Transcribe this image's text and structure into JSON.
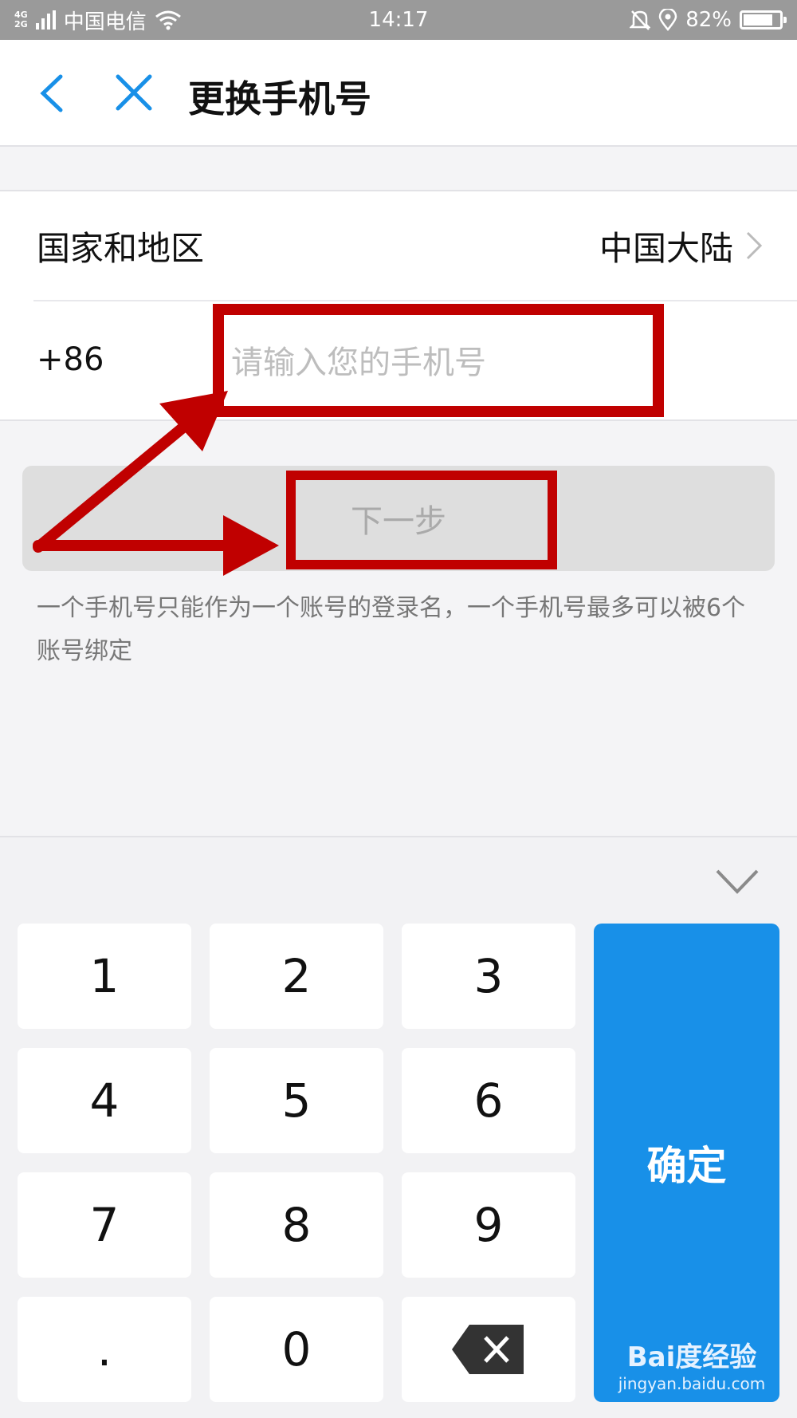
{
  "status_bar": {
    "network_types": [
      "4G",
      "2G"
    ],
    "carrier": "中国电信",
    "time": "14:17",
    "battery": "82%",
    "battery_level": 0.82,
    "icons": [
      "signal-icon",
      "wifi-icon",
      "bell-icon",
      "location-icon",
      "battery-icon"
    ]
  },
  "nav": {
    "title": "更换手机号",
    "icons": [
      "back-icon",
      "close-icon"
    ]
  },
  "form": {
    "region_label": "国家和地区",
    "region_value": "中国大陆",
    "country_code": "+86",
    "phone_placeholder": "请输入您的手机号",
    "phone_value": ""
  },
  "next_button_label": "下一步",
  "hint_text": "一个手机号只能作为一个账号的登录名，一个手机号最多可以被6个账号绑定",
  "keyboard": {
    "keys": [
      "1",
      "2",
      "3",
      "4",
      "5",
      "6",
      "7",
      "8",
      "9",
      ".",
      "0"
    ],
    "confirm_label": "确定",
    "icons": [
      "chevron-down-icon",
      "backspace-icon"
    ]
  },
  "watermark": {
    "logo_text": "Bai度经验",
    "url": "jingyan.baidu.com"
  },
  "colors": {
    "accent": "#1890e8",
    "annotation_red": "#c00000",
    "status_bar": "#9a9a9a",
    "disabled_button": "#dedede"
  }
}
